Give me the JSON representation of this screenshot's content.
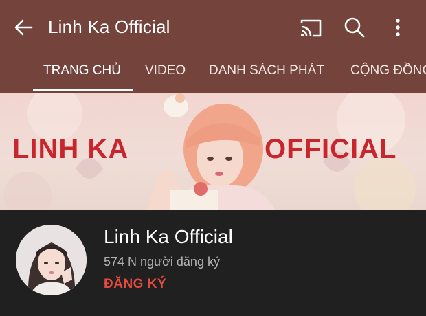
{
  "header": {
    "title": "Linh Ka Official",
    "back_icon": "arrow-left-icon",
    "cast_icon": "cast-icon",
    "search_icon": "search-icon",
    "more_icon": "more-vertical-icon",
    "background_color": "#74433c"
  },
  "tabs": [
    {
      "label": "TRANG CHỦ",
      "active": true
    },
    {
      "label": "VIDEO",
      "active": false
    },
    {
      "label": "DANH SÁCH PHÁT",
      "active": false
    },
    {
      "label": "CỘNG ĐỒNG",
      "active": false
    }
  ],
  "banner": {
    "left_text": "LINH KA",
    "right_text": "OFFICIAL",
    "text_color": "#c8262c"
  },
  "channel": {
    "name": "Linh Ka Official",
    "subscribers": "574 N người đăng ký",
    "subscribe_label": "ĐĂNG KÝ",
    "subscribe_color": "#e44a3d"
  }
}
